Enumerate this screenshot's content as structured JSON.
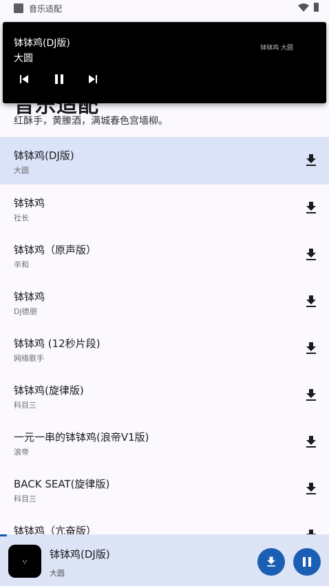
{
  "status_bar": {
    "title": "音乐适配"
  },
  "header": {
    "title": "音乐适配",
    "subtitle": "红酥手，黄縢酒，满城春色宫墙柳。"
  },
  "notification": {
    "song_title": "钵钵鸡(DJ版)",
    "artist": "大圆",
    "art_text": "钵钵鸡 大圆",
    "controls": [
      "skip-previous-icon",
      "pause-icon",
      "skip-next-icon"
    ]
  },
  "songs": [
    {
      "title": "钵钵鸡(DJ版)",
      "artist": "大圆",
      "selected": true
    },
    {
      "title": "钵钵鸡",
      "artist": "社长"
    },
    {
      "title": "钵钵鸡（原声版）",
      "artist": "辛和"
    },
    {
      "title": "钵钵鸡",
      "artist": "DJ德朋"
    },
    {
      "title": "钵钵鸡 (12秒片段)",
      "artist": "网络歌手"
    },
    {
      "title": "钵钵鸡(旋律版)",
      "artist": "科目三"
    },
    {
      "title": "一元一串的钵钵鸡(浪帝V1版)",
      "artist": "浪帝"
    },
    {
      "title": "BACK SEAT(旋律版)",
      "artist": "科目三"
    },
    {
      "title": "钵钵鸡（亢奋版）",
      "artist": ""
    }
  ],
  "player": {
    "title": "钵钵鸡(DJ版)",
    "artist": "大圆",
    "progress_fraction": 0.02
  },
  "colors": {
    "selected_row": "#dbe3f8",
    "accent": "#1b5fb4",
    "player_bg": "#dde4f6",
    "background": "#fbf9fe"
  }
}
